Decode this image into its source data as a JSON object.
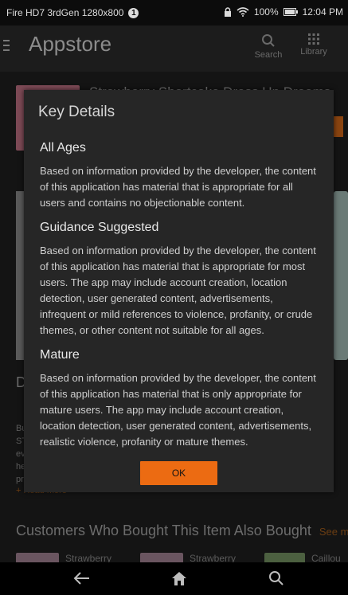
{
  "status_bar": {
    "device": "Fire HD7 3rdGen 1280x800",
    "notification_count": "1",
    "battery": "100%",
    "time": "12:04 PM"
  },
  "app_bar": {
    "title": "Appstore",
    "search_label": "Search",
    "library_label": "Library"
  },
  "background": {
    "app_title": "Strawberry Shortcake Dress Up Dreams",
    "description_letter": "D",
    "description_snippet": "Bu ST ev he pr",
    "read_more": "+ Read more",
    "related_section_title": "Customers Who Bought This Item Also Bought",
    "see_more": "See more",
    "related_items": [
      "Strawberry",
      "Strawberry",
      "Caillou C"
    ]
  },
  "dialog": {
    "title": "Key Details",
    "ratings": [
      {
        "heading": "All Ages",
        "text": "Based on information provided by the developer, the content of this application has material that is appropriate for all users and contains no objectionable content."
      },
      {
        "heading": "Guidance Suggested",
        "text": "Based on information provided by the developer, the content of this application has material that is appropriate for most users. The app may include account creation, location detection, user generated content, advertisements, infrequent or mild references to violence, profanity, or crude themes, or other content not suitable for all ages."
      },
      {
        "heading": "Mature",
        "text": "Based on information provided by the developer, the content of this application has material that is only appropriate for mature users. The app may include account creation, location detection, user generated content, advertisements, realistic violence, profanity or mature themes."
      }
    ],
    "ok_label": "OK"
  },
  "colors": {
    "accent": "#ec6b12",
    "dialog_bg": "#262626",
    "nav_bg": "#000000"
  }
}
